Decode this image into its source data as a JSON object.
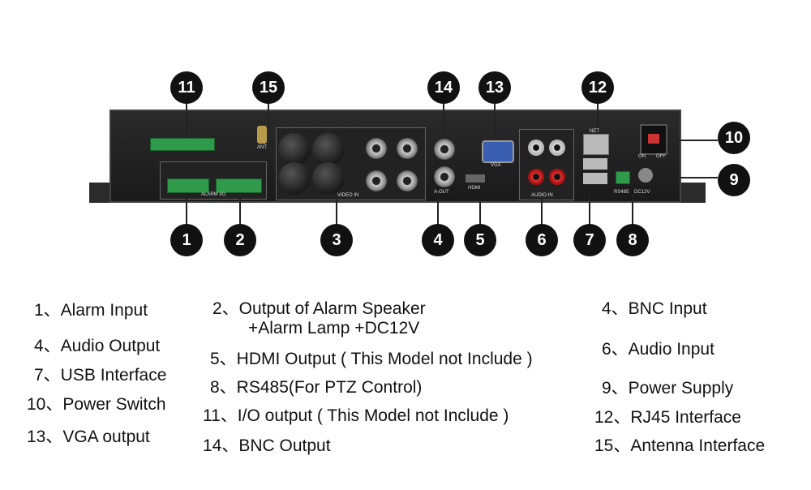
{
  "markers": [
    "11",
    "15",
    "14",
    "13",
    "12",
    "10",
    "9",
    "1",
    "2",
    "3",
    "4",
    "5",
    "6",
    "7",
    "8"
  ],
  "panel_labels": {
    "ant": "ANT",
    "video_in": "VIDEO IN",
    "a_out": "A-OUT",
    "vga": "VGA",
    "hdmi": "HDMI",
    "audio_in": "AUDIO IN",
    "net": "NET",
    "rs485": "RS485",
    "dc12v": "DC12V",
    "on": "ON",
    "off": "OFF",
    "alarm_io": "ALARM I/O"
  },
  "legend": {
    "col1": [
      "1、Alarm Input",
      "4、Audio Output",
      "7、USB Interface",
      "10、Power Switch",
      "13、VGA output"
    ],
    "col2": [
      "2、Output of Alarm  Speaker",
      "+Alarm Lamp +DC12V",
      "5、HDMI Output ( This Model not Include )",
      "8、RS485(For PTZ Control)",
      "11、I/O output ( This Model not Include )",
      "14、BNC Output"
    ],
    "col3": [
      "4、BNC Input",
      "6、Audio Input",
      "9、Power Supply",
      "12、RJ45 Interface",
      "15、Antenna Interface"
    ]
  }
}
